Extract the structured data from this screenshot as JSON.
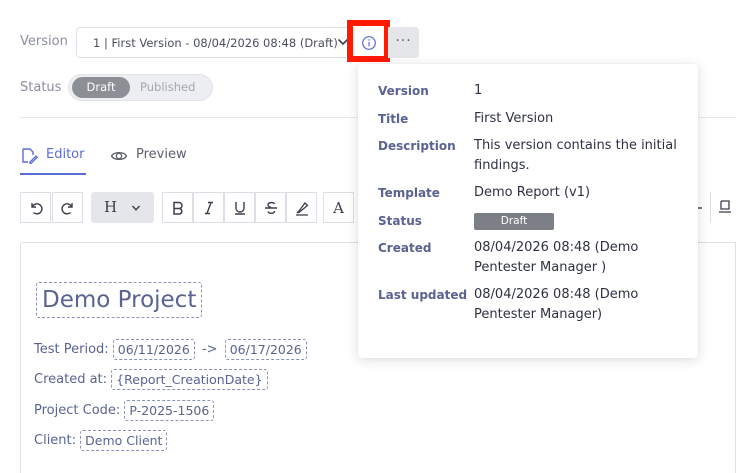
{
  "version": {
    "label": "Version",
    "selected": "1 | First Version - 08/04/2026 08:48 (Draft)",
    "more_label": "···"
  },
  "status": {
    "label": "Status",
    "options": [
      "Draft",
      "Published"
    ],
    "selected": "Draft"
  },
  "tabs": [
    {
      "label": "Editor",
      "active": true
    },
    {
      "label": "Preview",
      "active": false
    }
  ],
  "toolbar": {
    "heading_label": "H",
    "text_color_label": "A"
  },
  "document": {
    "title": "Demo Project",
    "test_period_label": "Test Period:",
    "test_period_start": "06/11/2026",
    "test_period_arrow": "->",
    "test_period_end": "06/17/2026",
    "created_at_label": "Created at:",
    "created_at_value": "{Report_CreationDate}",
    "project_code_label": "Project Code:",
    "project_code_value": "P-2025-1506",
    "client_label": "Client:",
    "client_value": "Demo Client"
  },
  "info_popover": {
    "version_key": "Version",
    "version_val": "1",
    "title_key": "Title",
    "title_val": "First Version",
    "description_key": "Description",
    "description_val": "This version contains the initial findings.",
    "template_key": "Template",
    "template_val": "Demo Report (v1)",
    "status_key": "Status",
    "status_val": "Draft",
    "created_key": "Created",
    "created_val": "08/04/2026 08:48 (Demo Pentester Manager )",
    "updated_key": "Last updated",
    "updated_val": "08/04/2026 08:48 (Demo Pentester Manager)"
  },
  "colors": {
    "accent": "#5b6bd6",
    "highlight": "#ff1a00",
    "draft_badge": "#7d7f86",
    "placeholder_text": "#5b6392"
  },
  "icons": [
    "chevron-down-icon",
    "info-icon",
    "more-icon",
    "edit-icon",
    "eye-icon",
    "undo-icon",
    "redo-icon",
    "bold-icon",
    "italic-icon",
    "underline-icon",
    "strikethrough-icon",
    "highlighter-icon"
  ]
}
